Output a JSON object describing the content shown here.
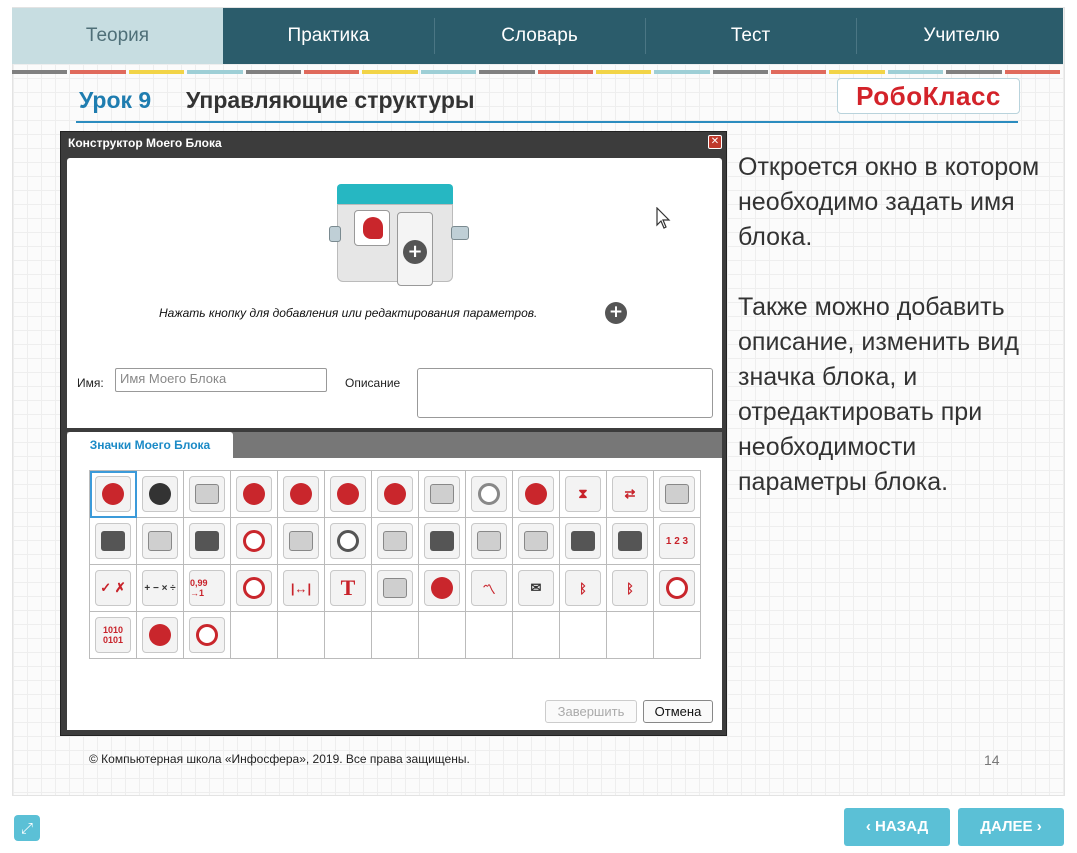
{
  "nav": {
    "tabs": [
      "Теория",
      "Практика",
      "Словарь",
      "Тест",
      "Учителю"
    ],
    "active_index": 0
  },
  "stripe_colors": [
    "#808080",
    "#e06a5c",
    "#f2d447",
    "#9ecfd6",
    "#808080",
    "#e06a5c",
    "#f2d447",
    "#9ecfd6",
    "#808080",
    "#e06a5c",
    "#f2d447",
    "#9ecfd6",
    "#808080",
    "#e06a5c",
    "#f2d447",
    "#9ecfd6",
    "#808080",
    "#e06a5c"
  ],
  "header": {
    "lesson_number": "Урок 9",
    "lesson_title": "Управляющие структуры",
    "logo_text": "РобоКласс"
  },
  "dialog": {
    "title": "Конструктор Моего Блока",
    "hint": "Нажать кнопку для добавления или редактирования параметров.",
    "name_label": "Имя:",
    "name_placeholder": "Имя Моего Блока",
    "description_label": "Описание",
    "icons_tab": "Значки Моего Блока",
    "finish_button": "Завершить",
    "cancel_button": "Отмена",
    "icons": [
      "head-icon",
      "gear-head-icon",
      "medium-motor-icon",
      "large-motor-icon",
      "move-steering-icon",
      "move-tank-icon",
      "motor-control-icon",
      "display-icon",
      "sound-icon",
      "brick-status-light-icon",
      "timer-hourglass-icon",
      "loop-interrupt-icon",
      "motor-unregulated-icon",
      "touch-sensor-icon",
      "gyro-sensor-icon",
      "color-sensor-icon",
      "infrared-sensor-icon",
      "rotation-sensor-icon",
      "timer-icon",
      "ultrasonic-sensor-icon",
      "infrared-beacon-icon",
      "brick-buttons-icon",
      "energy-meter-icon",
      "briefcase-icon",
      "locked-briefcase-icon",
      "array-icon",
      "logic-icon",
      "math-icon",
      "round-icon",
      "compare-icon",
      "range-icon",
      "text-icon",
      "random-icon",
      "file-icon",
      "data-log-icon",
      "messaging-icon",
      "bluetooth-icon",
      "bluetooth-connect-icon",
      "stop-icon",
      "raw-sensor-icon",
      "invert-motor-icon",
      "unregulated-icon"
    ],
    "icon_labels": {
      "round": "0,99 →1",
      "compare": "≷",
      "range": "|↔|",
      "text": "T",
      "raw": "1010 0101",
      "array": "1 2 3",
      "math": "+ − × ÷",
      "logic": "✓ ✗"
    }
  },
  "body_text": {
    "paragraph_1": "Откроется окно в котором необходимо задать имя блока.",
    "paragraph_2": "Также можно добавить описание, изменить вид значка блока, и отредактировать  при необходимости параметры блока."
  },
  "footer": {
    "copyright": "© Компьютерная школа «Инфосфера», 2019.  Все права защищены.",
    "page_number": "14"
  },
  "bottom_nav": {
    "back_label": "‹ НАЗАД",
    "next_label": "ДАЛЕЕ ›"
  }
}
